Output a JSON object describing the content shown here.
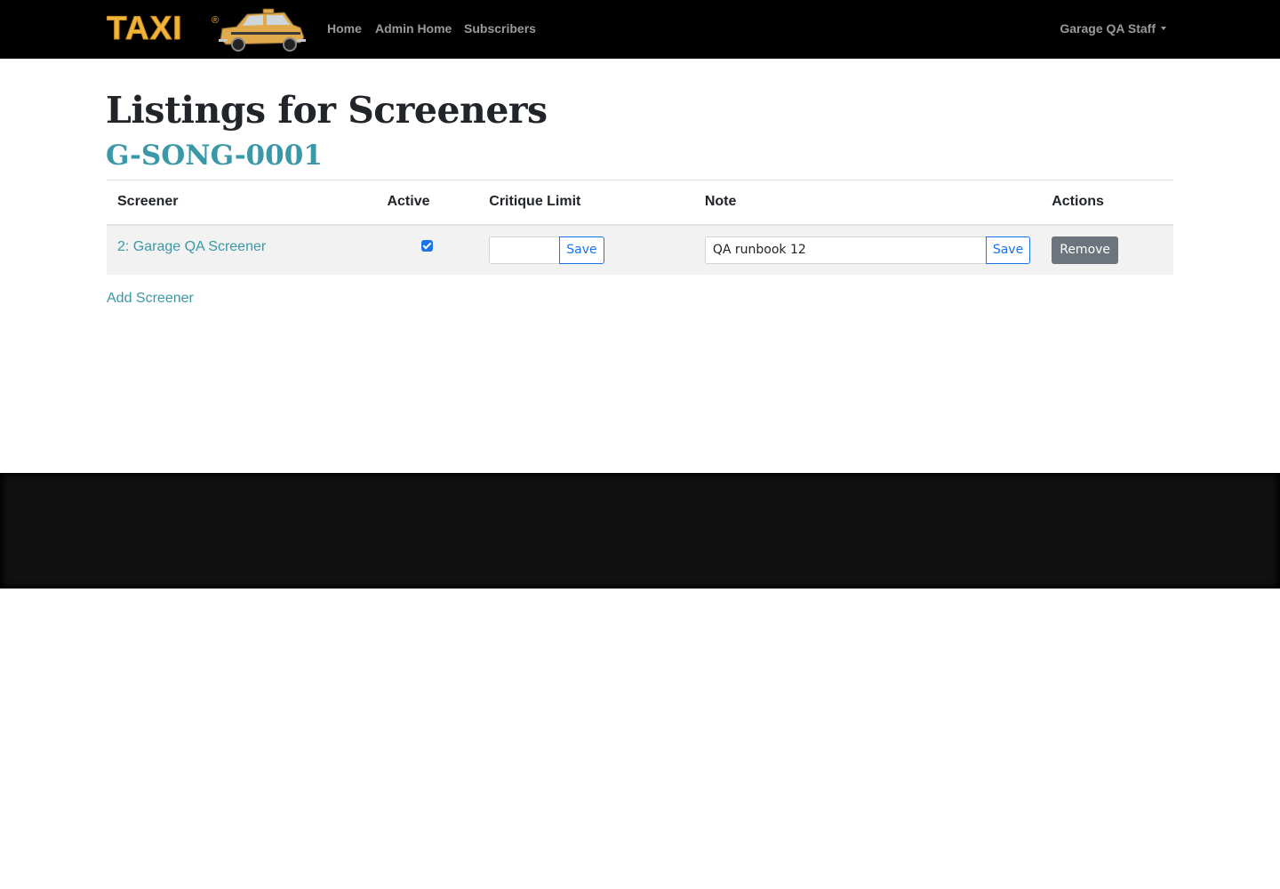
{
  "navbar": {
    "brand_text": "TAXI",
    "registered_mark": "®",
    "links": [
      "Home",
      "Admin Home",
      "Subscribers"
    ],
    "user_menu": "Garage QA Staff"
  },
  "page": {
    "title": "Listings for Screeners",
    "listing_code": "G-SONG-0001"
  },
  "table": {
    "headers": [
      "Screener",
      "Active",
      "Critique Limit",
      "Note",
      "Actions"
    ],
    "rows": [
      {
        "screener": "2: Garage QA Screener",
        "active": true,
        "critique_limit": "",
        "note": "QA runbook 12",
        "save_label": "Save",
        "remove_label": "Remove"
      }
    ]
  },
  "add_screener_label": "Add Screener",
  "colors": {
    "navbar": "#000000",
    "link": "#3a98a8",
    "primary": "#1a73e8",
    "secondary_button": "#6c757d",
    "footer": "#111111"
  }
}
